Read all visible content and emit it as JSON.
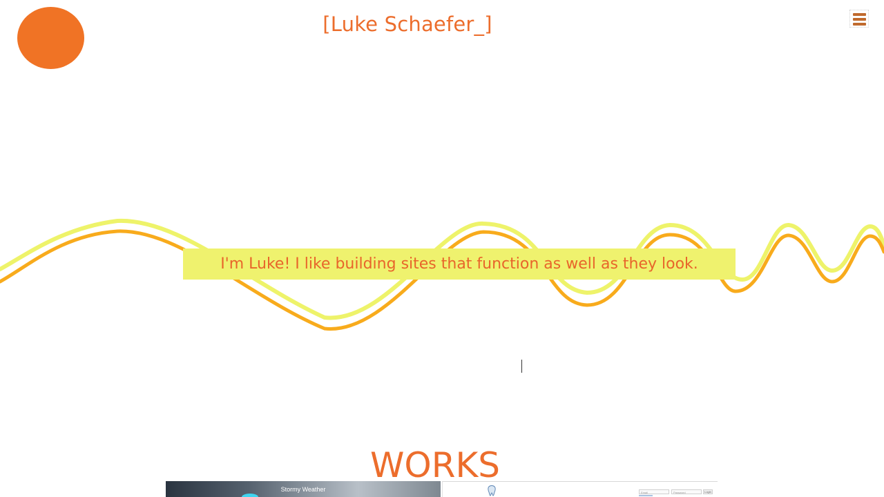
{
  "header": {
    "site_title": "[Luke Schaefer_]",
    "logo_icon": "orange-circle-logo",
    "menu_icon": "hamburger-icon"
  },
  "hero": {
    "intro": "I'm Luke!  I like building sites that function as well as they look."
  },
  "works": {
    "heading": "WORKS",
    "items": [
      {
        "title": "Stormy Weather"
      },
      {
        "login_fields": [
          "Email",
          "Password"
        ],
        "login_button": "Login"
      }
    ]
  },
  "colors": {
    "accent": "#f07325",
    "title_text": "#ec6d2c",
    "banner_bg": "#eff26e",
    "wave_yellow": "#eef36a",
    "wave_orange": "#f8ab1c",
    "menu_icon": "#c06a2d"
  }
}
